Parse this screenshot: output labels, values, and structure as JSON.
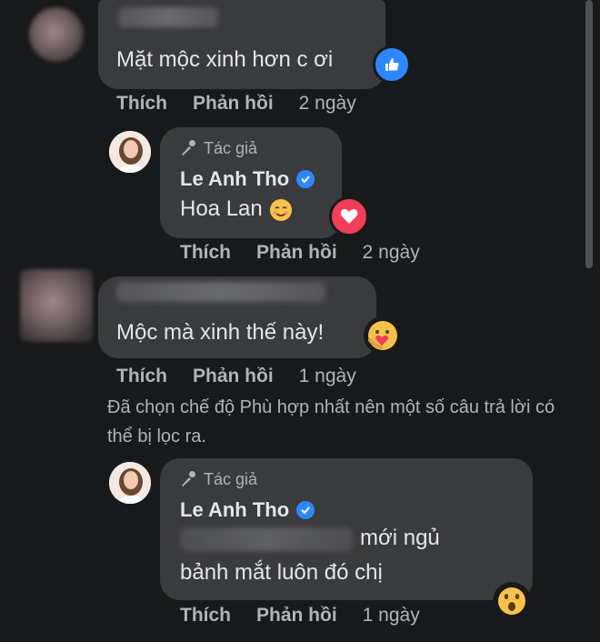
{
  "comments": [
    {
      "text": "Mặt mộc xinh hơn c ơi",
      "actions": {
        "like": "Thích",
        "reply": "Phản hồi",
        "time": "2 ngày"
      }
    },
    {
      "author_tag": "Tác giả",
      "name": "Le Anh Tho",
      "text": "Hoa Lan",
      "actions": {
        "like": "Thích",
        "reply": "Phản hồi",
        "time": "2 ngày"
      }
    },
    {
      "text": "Mộc mà xinh thế này!",
      "actions": {
        "like": "Thích",
        "reply": "Phản hồi",
        "time": "1 ngày"
      }
    },
    {
      "author_tag": "Tác giả",
      "name": "Le Anh Tho",
      "text_line1": "mới ngủ",
      "text_line2": "bảnh mắt luôn đó chị",
      "actions": {
        "like": "Thích",
        "reply": "Phản hồi",
        "time": "1 ngày"
      }
    }
  ],
  "filter_note": "Đã chọn chế độ Phù hợp nhất nên một số câu trả lời có thể bị lọc ra.",
  "colors": {
    "background": "#18191a",
    "bubble": "#3a3b3c",
    "like_blue": "#2d88ff",
    "love_red": "#f33e58"
  },
  "icons": [
    "like-reaction-icon",
    "love-reaction-icon",
    "care-reaction-icon",
    "wow-reaction-icon",
    "microphone-icon",
    "verified-badge-icon",
    "smiling-emoji-icon"
  ]
}
